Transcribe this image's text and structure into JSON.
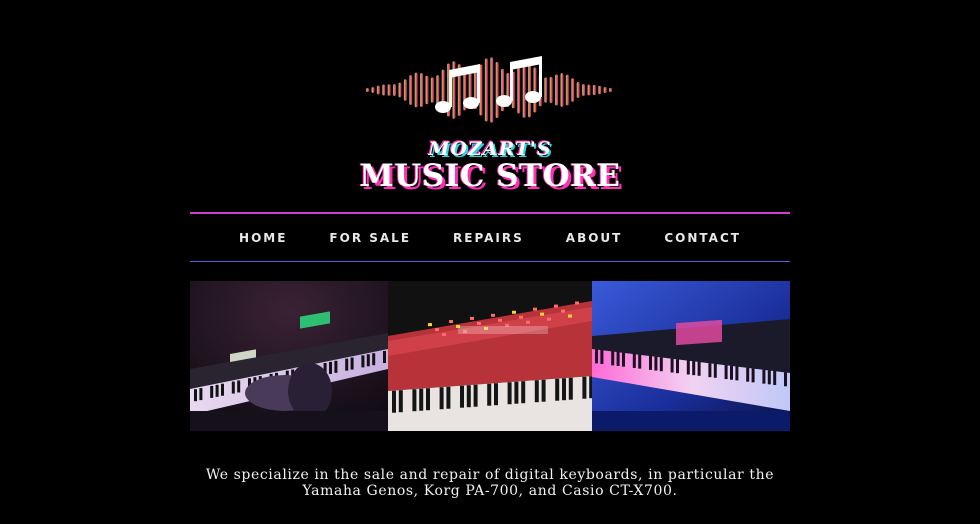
{
  "logo": {
    "small_text": "MOZART'S",
    "big_text": "MUSIC STORE",
    "icon": "music-notes-soundwave-icon",
    "colors": [
      "#3aa89a",
      "#e6a03a",
      "#f06a3a",
      "#e0357a",
      "#c42fa0"
    ]
  },
  "nav": {
    "items": [
      {
        "label": "HOME"
      },
      {
        "label": "FOR SALE"
      },
      {
        "label": "REPAIRS"
      },
      {
        "label": "ABOUT"
      },
      {
        "label": "CONTACT"
      }
    ],
    "line_top_color": "#d63ad6",
    "line_bottom_color": "#6a52e6"
  },
  "banner": {
    "panels": [
      {
        "name": "keyboard-photo-purple"
      },
      {
        "name": "keyboard-photo-red"
      },
      {
        "name": "keyboard-photo-blue"
      }
    ]
  },
  "intro": {
    "text": "We specialize in the sale and repair of digital keyboards, in particular the Yamaha Genos, Korg PA-700, and Casio CT-X700."
  }
}
